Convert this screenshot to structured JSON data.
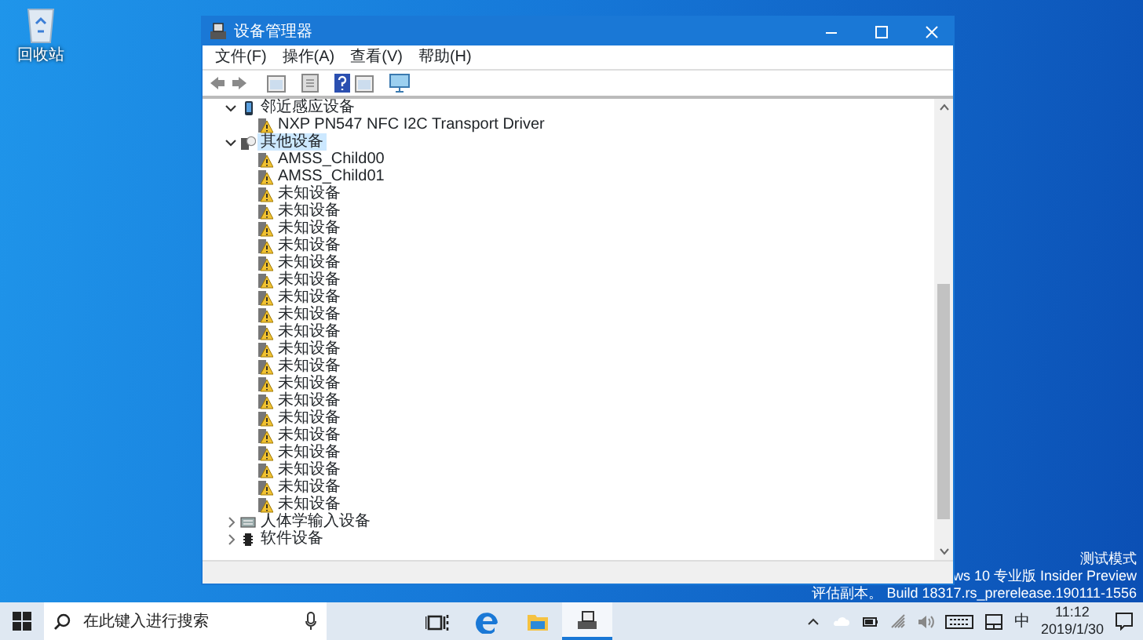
{
  "desktop": {
    "icons": [
      {
        "label": "回收站"
      }
    ],
    "build_info": [
      "测试模式",
      "ws 10 专业版 Insider Preview",
      "评估副本。 Build 18317.rs_prerelease.190111-1556"
    ]
  },
  "window": {
    "title": "设备管理器",
    "menu": [
      "文件(F)",
      "操作(A)",
      "查看(V)",
      "帮助(H)"
    ],
    "tree": [
      {
        "label": "邻近感应设备",
        "kind": "phone",
        "expanded": true,
        "selected": false,
        "children": [
          {
            "label": "NXP PN547 NFC I2C Transport Driver",
            "kind": "unknown",
            "selected": false
          }
        ]
      },
      {
        "label": "其他设备",
        "kind": "other",
        "expanded": true,
        "selected": true,
        "children": [
          {
            "label": "AMSS_Child00",
            "kind": "unknown",
            "selected": false
          },
          {
            "label": "AMSS_Child01",
            "kind": "unknown",
            "selected": false
          },
          {
            "label": "未知设备",
            "kind": "unknown",
            "selected": false
          },
          {
            "label": "未知设备",
            "kind": "unknown",
            "selected": false
          },
          {
            "label": "未知设备",
            "kind": "unknown",
            "selected": false
          },
          {
            "label": "未知设备",
            "kind": "unknown",
            "selected": false
          },
          {
            "label": "未知设备",
            "kind": "unknown",
            "selected": false
          },
          {
            "label": "未知设备",
            "kind": "unknown",
            "selected": false
          },
          {
            "label": "未知设备",
            "kind": "unknown",
            "selected": false
          },
          {
            "label": "未知设备",
            "kind": "unknown",
            "selected": false
          },
          {
            "label": "未知设备",
            "kind": "unknown",
            "selected": false
          },
          {
            "label": "未知设备",
            "kind": "unknown",
            "selected": false
          },
          {
            "label": "未知设备",
            "kind": "unknown",
            "selected": false
          },
          {
            "label": "未知设备",
            "kind": "unknown",
            "selected": false
          },
          {
            "label": "未知设备",
            "kind": "unknown",
            "selected": false
          },
          {
            "label": "未知设备",
            "kind": "unknown",
            "selected": false
          },
          {
            "label": "未知设备",
            "kind": "unknown",
            "selected": false
          },
          {
            "label": "未知设备",
            "kind": "unknown",
            "selected": false
          },
          {
            "label": "未知设备",
            "kind": "unknown",
            "selected": false
          },
          {
            "label": "未知设备",
            "kind": "unknown",
            "selected": false
          },
          {
            "label": "未知设备",
            "kind": "unknown",
            "selected": false
          }
        ]
      },
      {
        "label": "人体学输入设备",
        "kind": "keyboard",
        "expanded": false,
        "selected": false
      },
      {
        "label": "软件设备",
        "kind": "chip",
        "expanded": false,
        "selected": false
      }
    ]
  },
  "taskbar": {
    "search": {
      "placeholder": "在此键入进行搜索"
    },
    "apps": [
      {
        "kind": "task-view",
        "active": false
      },
      {
        "kind": "edge",
        "active": false
      },
      {
        "kind": "explorer",
        "active": false
      },
      {
        "kind": "device-manager",
        "active": true
      }
    ],
    "tray": {
      "ime": "中",
      "time": "11:12",
      "date": "2019/1/30"
    }
  }
}
